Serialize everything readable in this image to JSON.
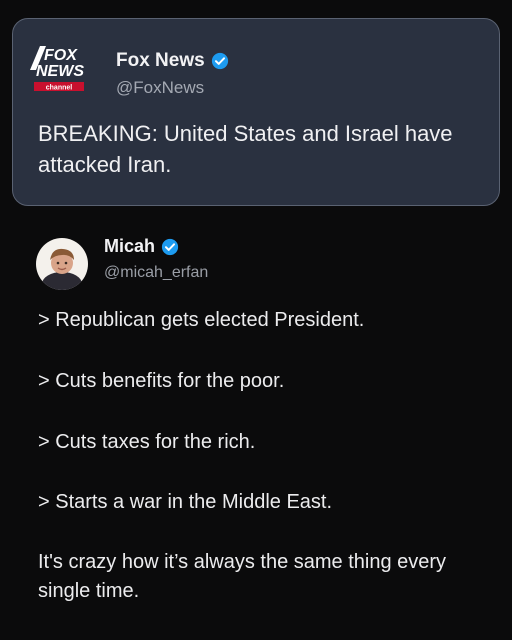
{
  "quoted_post": {
    "logo_top": "FOX",
    "logo_mid": "NEWS",
    "logo_bottom": "channel",
    "author_name": "Fox News",
    "author_handle": "@FoxNews",
    "text": "BREAKING: United States and Israel have attacked Iran.",
    "verified_icon": "verified-badge-icon"
  },
  "post": {
    "author_name": "Micah",
    "author_handle": "@micah_erfan",
    "verified_icon": "verified-badge-icon",
    "lines": [
      "> Republican gets elected President.",
      "> Cuts benefits for the poor.",
      "> Cuts taxes for the rich.",
      "> Starts a war in the Middle East."
    ],
    "closing": "It's crazy how it’s always the same thing every single time."
  },
  "colors": {
    "background": "#0b0b0c",
    "card": "#2a3140",
    "verified": "#1d9bf0"
  }
}
